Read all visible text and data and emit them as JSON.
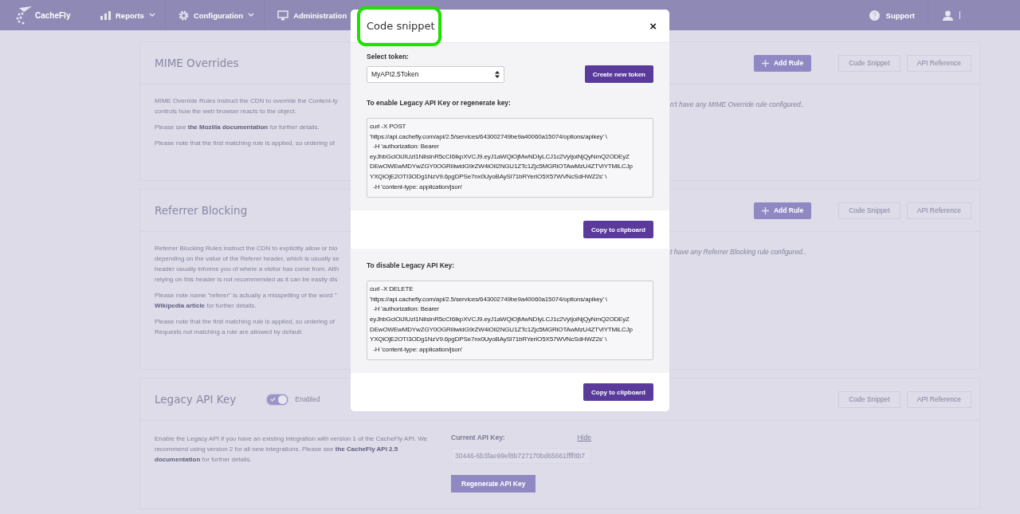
{
  "nav": {
    "logo": "CacheFly",
    "items": [
      {
        "label": "Reports",
        "dropdown": true
      },
      {
        "label": "Configuration",
        "dropdown": true
      },
      {
        "label": "Administration",
        "dropdown": false
      }
    ],
    "support": "Support"
  },
  "sections": [
    {
      "kind": "rules",
      "title": "MIME Overrides",
      "add_button": "Add Rule",
      "buttons": [
        "Code Snippet",
        "API Reference"
      ],
      "paragraphs": [
        "MIME Override Rules instruct the CDN to override the Content-ty\ncontrols how the web browser reacts to the object.",
        "Please see **the Mozilla documentation** for further details.",
        "Please note that the first matching rule is applied, so ordering of"
      ],
      "empty_note": "n't have any MIME Override rule configured.."
    },
    {
      "kind": "rules",
      "title": "Referrer Blocking",
      "add_button": "Add Rule",
      "buttons": [
        "Code Snippet",
        "API Reference"
      ],
      "paragraphs": [
        "Referrer Blocking Rules instruct the CDN to explicitly allow or blo\ndepending on the value of the Referer header, which is usually se\nheader usually informs you of where a visitor has come from. Alth\nrelying on this header is not recommended as it can be easily dis",
        "Please note name \"referer\" is actually a misspelling of the word \"\n**Wikipedia article** for further details.",
        "Please note that the first matching rule is applied, so ordering of\nRequests not matching a rule are allowed by default."
      ],
      "empty_note": "t have any Referrer Blocking rule configured.."
    },
    {
      "kind": "legacy",
      "title": "Legacy API Key",
      "toggle": {
        "on": true,
        "label": "Enabled"
      },
      "buttons": [
        "Code Snippet",
        "API Reference"
      ],
      "description": "Enable the Legacy API if you have an existing integration with version 1 of the CacheFly API. We recommend using version 2 for all new integrations. Please see **the CacheFly API 2.5 documentation** for further details.",
      "key_label": "Current API Key:",
      "hide_link": "Hide",
      "key_value": "30446-6b3fae99ef8b727170bd65661ffff8b7",
      "regenerate_button": "Regenerate API Key"
    }
  ],
  "modal": {
    "title": "Code snippet",
    "close": "×",
    "token_label": "Select token:",
    "token_value": "MyAPI2.5Token",
    "create_button": "Create new token",
    "snippets": [
      {
        "label": "To enable Legacy API Key or regenerate key:",
        "code": "curl -X POST\n'https://api.cachefly.com/api/2.5/services/643002749be9a40060a15074/options/apikey' \\\n  -H 'authorization: Bearer\neyJhbGciOiJIUzI1NiIsInR5cCI6IkpXVCJ9.eyJ1aWQiOjMwNDIyLCJ1c2VyIjoiNjQyNmQ2ODEyZ\nDEwOWEwMDYwZGY0OGRiIiwidG9rZW4iOiI2NGU1ZTc1Zjc5MGRiOTAwMzU4ZTViYTMiLCJp\nYXQiOjE2OTI3ODg1NzV9.6pgDPSe7nx0UyoBAySl71bRYerIO5X57WVNcSdHWZ2s' \\\n  -H 'content-type: application/json'",
        "copy_button": "Copy to clipboard"
      },
      {
        "label": "To disable Legacy API Key:",
        "code": "curl -X DELETE\n'https://api.cachefly.com/api/2.5/services/643002749be9a40060a15074/options/apikey' \\\n  -H 'authorization: Bearer\neyJhbGciOiJIUzI1NiIsInR5cCI6IkpXVCJ9.eyJ1aWQiOjMwNDIyLCJ1c2VyIjoiNjQyNmQ2ODEyZ\nDEwOWEwMDYwZGY0OGRiIiwidG9rZW4iOiI2NGU1ZTc1Zjc5MGRiOTAwMzU4ZTViYTMiLCJp\nYXQiOjE2OTI3ODg1NzV9.6pgDPSe7nx0UyoBAySl71bRYerIO5X57WVNcSdHWZ2s' \\\n  -H 'content-type: application/json'",
        "copy_button": "Copy to clipboard"
      }
    ]
  }
}
